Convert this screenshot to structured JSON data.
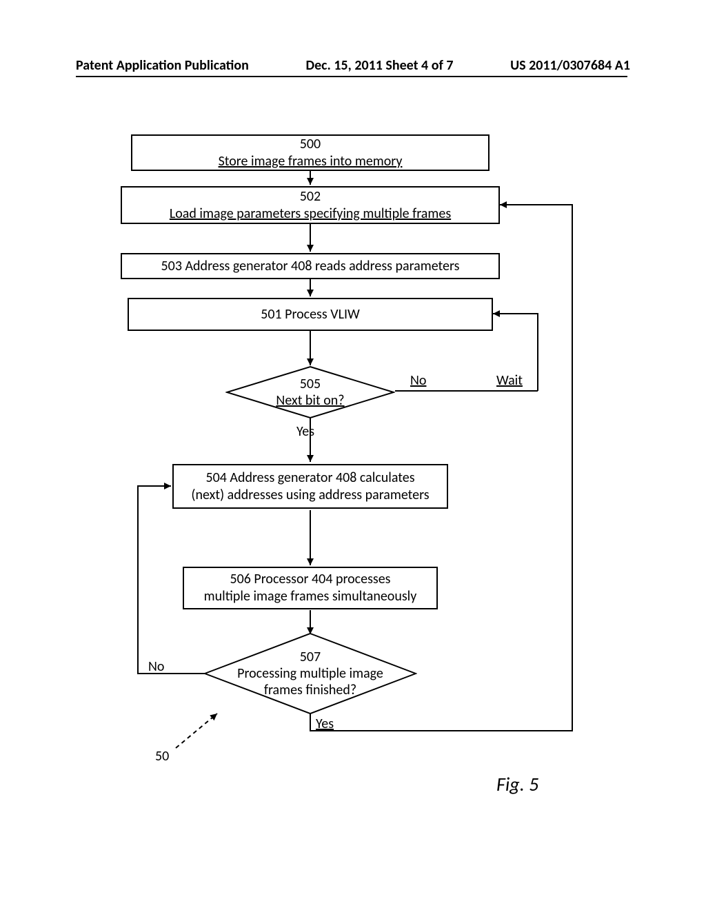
{
  "header": {
    "left": "Patent Application Publication",
    "center": "Dec. 15, 2011  Sheet 4 of 7",
    "right": "US 2011/0307684 A1"
  },
  "nodes": {
    "n500": {
      "num": "500",
      "text": "Store  image frames into memory"
    },
    "n502": {
      "num": "502",
      "text": "Load image  parameters specifying  multiple frames"
    },
    "n503": {
      "text": "503 Address generator 408 reads address parameters"
    },
    "n501": {
      "text": "501 Process VLIW"
    },
    "n505": {
      "num": "505",
      "text": "Next bit  on?"
    },
    "n504": {
      "text1": "504 Address generator 408 calculates",
      "text2": "(next) addresses using address parameters"
    },
    "n506": {
      "text1": "506 Processor 404 processes",
      "text2": "multiple image frames simultaneously"
    },
    "n507": {
      "num": "507",
      "text1": "Processing multiple image",
      "text2": "frames finished?"
    }
  },
  "edges": {
    "yes1": "Yes",
    "no1": "No",
    "wait": "Wait",
    "yes2": "Yes",
    "no2": "No"
  },
  "ref": "50",
  "figure": "Fig. 5"
}
